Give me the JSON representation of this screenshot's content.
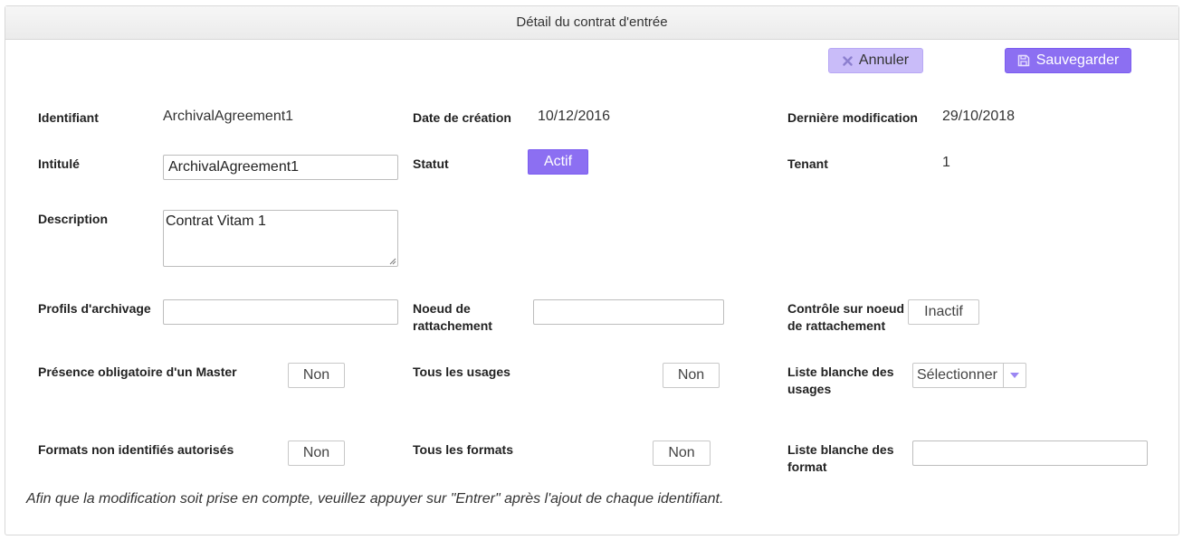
{
  "header": {
    "title": "Détail du contrat d'entrée"
  },
  "toolbar": {
    "cancel_label": "Annuler",
    "save_label": "Sauvegarder"
  },
  "fields": {
    "identifier": {
      "label": "Identifiant",
      "value": "ArchivalAgreement1"
    },
    "creation_date": {
      "label": "Date de création",
      "value": "10/12/2016"
    },
    "last_modified": {
      "label": "Dernière modification",
      "value": "29/10/2018"
    },
    "title": {
      "label": "Intitulé",
      "value": "ArchivalAgreement1"
    },
    "status": {
      "label": "Statut",
      "value": "Actif"
    },
    "tenant": {
      "label": "Tenant",
      "value": "1"
    },
    "description": {
      "label": "Description",
      "value": "Contrat Vitam 1"
    },
    "archive_profiles": {
      "label": "Profils d'archivage",
      "value": ""
    },
    "attachment_node": {
      "label_line1": "Noeud de",
      "label_line2": "rattachement",
      "value": ""
    },
    "attachment_node_control": {
      "label_line1": "Contrôle sur noeud",
      "label_line2": "de rattachement",
      "value": "Inactif"
    },
    "master_mandatory": {
      "label": "Présence obligatoire d'un Master",
      "value": "Non"
    },
    "all_usages": {
      "label": "Tous les usages",
      "value": "Non"
    },
    "usage_whitelist": {
      "label_line1": "Liste blanche des",
      "label_line2": "usages",
      "value": "Sélectionner"
    },
    "unidentified_formats": {
      "label": "Formats non identifiés autorisés",
      "value": "Non"
    },
    "all_formats": {
      "label": "Tous les formats",
      "value": "Non"
    },
    "format_whitelist": {
      "label_line1": "Liste blanche des",
      "label_line2": "format",
      "value": ""
    }
  },
  "footer_note": "Afin que la modification soit prise en compte, veuillez appuyer sur \"Entrer\" après l'ajout de chaque identifiant.",
  "colors": {
    "accent": "#8c6ff2",
    "accent_light": "#c9bcf9"
  }
}
